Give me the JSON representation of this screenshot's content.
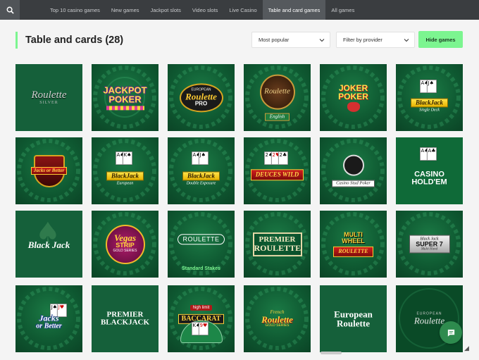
{
  "nav": {
    "search_icon": "search-icon",
    "items": [
      {
        "label": "Top 10 casino games",
        "active": false
      },
      {
        "label": "New games",
        "active": false
      },
      {
        "label": "Jackpot slots",
        "active": false
      },
      {
        "label": "Video slots",
        "active": false
      },
      {
        "label": "Live Casino",
        "active": false
      },
      {
        "label": "Table and card games",
        "active": true
      },
      {
        "label": "All games",
        "active": false
      }
    ]
  },
  "section": {
    "title": "Table and cards (28)",
    "sort_value": "Most popular",
    "provider_value": "Filter by provider",
    "hide_label": "Hide games"
  },
  "colors": {
    "accent": "#7cf590",
    "nav_bg": "#3a3d40",
    "tile_green": "#0f5630",
    "chat_green": "#2e8b4e"
  },
  "games": {
    "roulette_silver": {
      "line1": "Roulette",
      "line2": "SILVER"
    },
    "jackpot_poker": {
      "line1": "JACKPOT",
      "line2": "POKER"
    },
    "european_roulette_pro": {
      "line1": "EUROPEAN",
      "line2": "Roulette",
      "line3": "PRO"
    },
    "roulette_english": {
      "line1": "Roulette",
      "line2": "English"
    },
    "joker_poker": {
      "line1": "JOKER",
      "line2": "POKER"
    },
    "blackjack_single_deck": {
      "line1": "BlackJack",
      "line2": "Single Deck"
    },
    "jacks_or_better_shield": {
      "line1": "Jacks or Better"
    },
    "blackjack_european": {
      "line1": "BlackJack",
      "line2": "European"
    },
    "blackjack_double_exposure": {
      "line1": "BlackJack",
      "line2": "Double Exposure"
    },
    "deuces_wild": {
      "line1": "DEUCES WILD"
    },
    "casino_stud_poker": {
      "line1": "Casino Stud Poker"
    },
    "casino_holdem": {
      "line1": "CASINO",
      "line2": "HOLD'EM"
    },
    "black_jack": {
      "line1": "Black Jack"
    },
    "vegas_strip": {
      "line1": "Vegas",
      "line2": "STRIP",
      "line3": "GOLD SERIES"
    },
    "roulette_standard": {
      "line1": "ROULETTE",
      "line2": "Standard Stakes"
    },
    "premier_roulette": {
      "line1": "PREMIER",
      "line2": "ROULETTE"
    },
    "multi_wheel_roulette": {
      "line1": "MULTI",
      "line2": "WHEEL",
      "line3": "ROULETTE"
    },
    "blackjack_super7": {
      "line1": "Black Jack",
      "line2": "SUPER 7",
      "line3": "Multi Hand"
    },
    "jacks_or_better": {
      "line1": "Jacks",
      "line2": "or Better"
    },
    "premier_blackjack": {
      "line1": "PREMIER",
      "line2": "BLACKJACK"
    },
    "baccarat_high_limit": {
      "line1": "high limit",
      "line2": "BACCARAT"
    },
    "french_roulette": {
      "line1": "French",
      "line2": "Roulette",
      "line3": "GOLD SERIES"
    },
    "european_roulette": {
      "line1": "European",
      "line2": "Roulette"
    },
    "european_roulette_gold": {
      "line1": "EUROPEAN",
      "line2": "Roulette"
    }
  }
}
